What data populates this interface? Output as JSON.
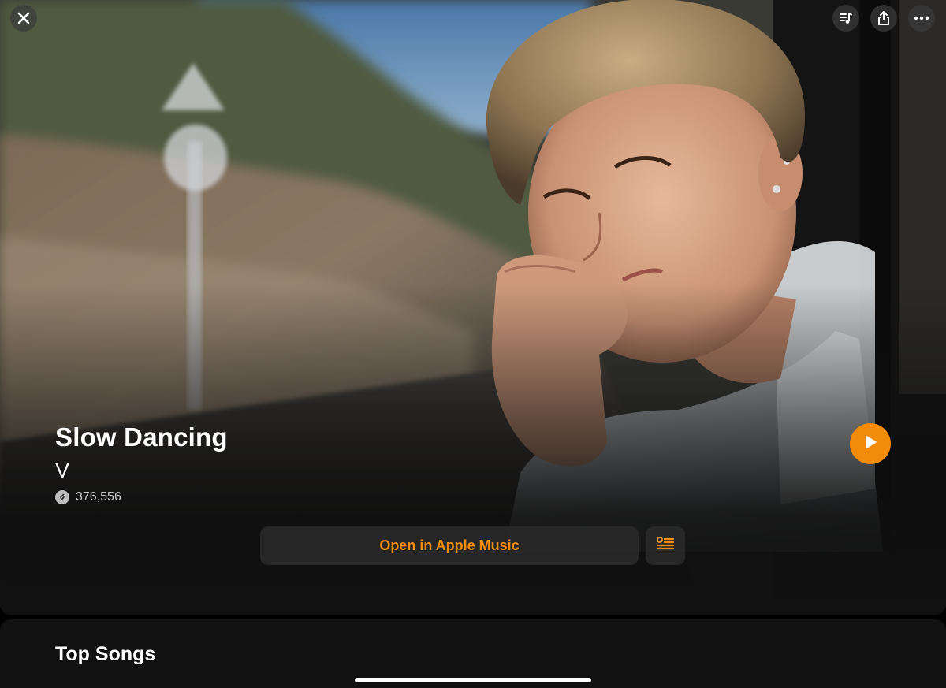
{
  "song": {
    "title": "Slow Dancing",
    "artist": "V",
    "shazam_count": "376,556"
  },
  "actions": {
    "open_label": "Open in Apple Music"
  },
  "sections": {
    "top_songs": "Top Songs"
  },
  "colors": {
    "accent": "#f28a0a",
    "background": "#111111"
  },
  "icons": {
    "close": "close-icon",
    "queue": "music-queue-icon",
    "share": "share-icon",
    "more": "more-icon",
    "play": "play-icon",
    "lyrics": "lyrics-icon",
    "shazam": "shazam-icon"
  }
}
